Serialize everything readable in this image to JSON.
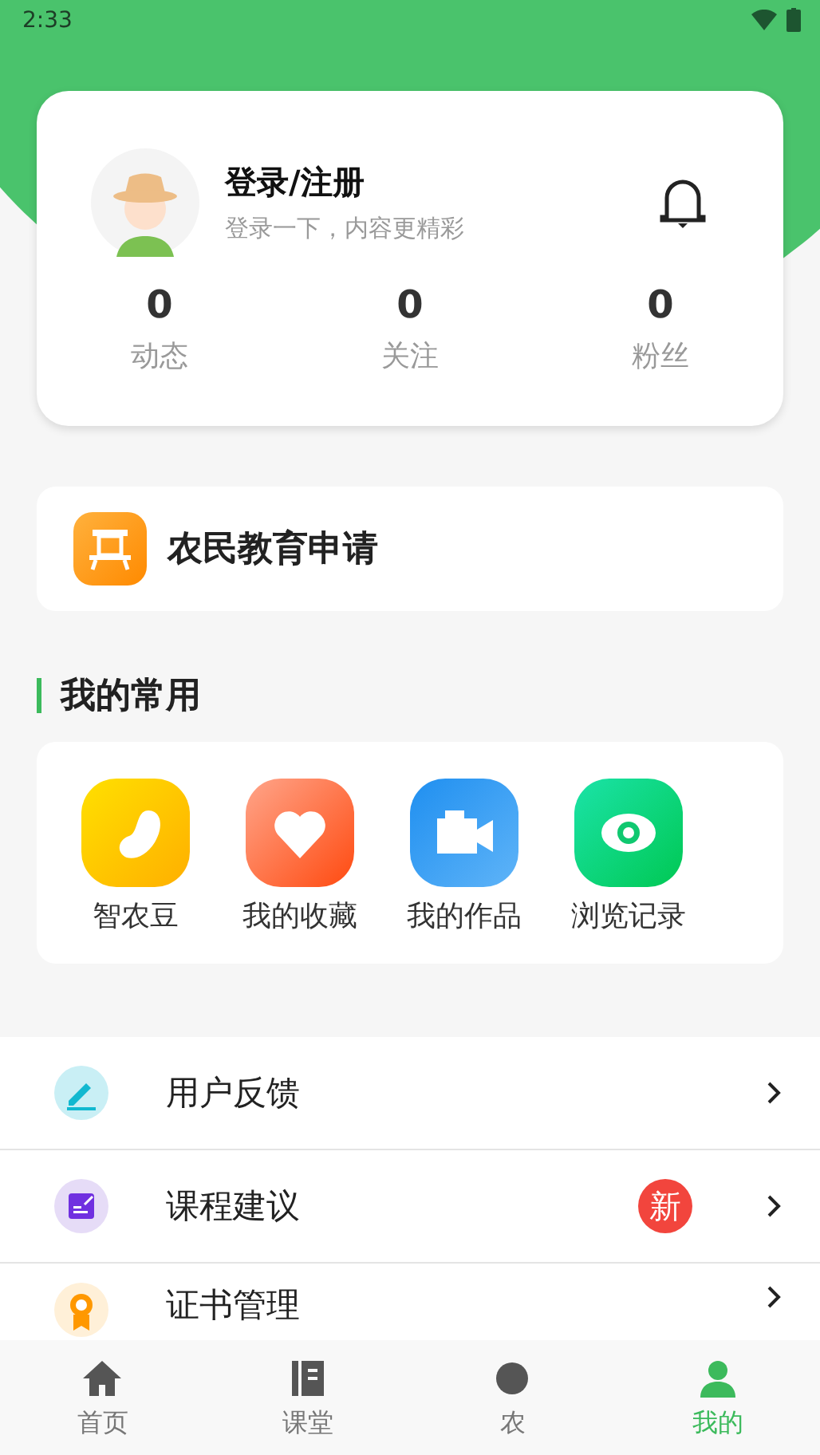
{
  "status_bar": {
    "time": "2:33"
  },
  "profile": {
    "title": "登录/注册",
    "subtitle": "登录一下，内容更精彩",
    "stats": [
      {
        "value": "0",
        "label": "动态"
      },
      {
        "value": "0",
        "label": "关注"
      },
      {
        "value": "0",
        "label": "粉丝"
      }
    ]
  },
  "apply_card": {
    "label": "农民教育申请"
  },
  "common": {
    "heading": "我的常用",
    "items": [
      {
        "kind": "bean",
        "label": "智农豆"
      },
      {
        "kind": "heart",
        "label": "我的收藏"
      },
      {
        "kind": "video",
        "label": "我的作品"
      },
      {
        "kind": "eye",
        "label": "浏览记录"
      }
    ]
  },
  "menu": [
    {
      "kind": "pen",
      "label": "用户反馈"
    },
    {
      "kind": "note",
      "label": "课程建议",
      "badge": "新"
    },
    {
      "kind": "medal",
      "label": "证书管理"
    }
  ],
  "tabs": [
    {
      "kind": "home",
      "label": "首页",
      "selected": false
    },
    {
      "kind": "book",
      "label": "课堂",
      "selected": false
    },
    {
      "kind": "other",
      "label": "农",
      "selected": false
    },
    {
      "kind": "person",
      "label": "我的",
      "selected": true
    }
  ]
}
